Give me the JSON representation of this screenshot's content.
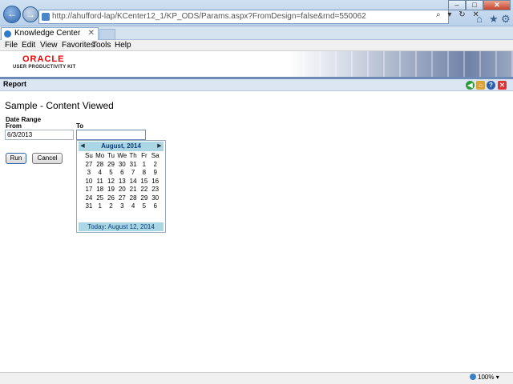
{
  "browser": {
    "url": "http://ahufford-lap/KCenter12_1/KP_ODS/Params.aspx?FromDesign=false&rnd=550062",
    "tab_title": "Knowledge Center",
    "tab_close": "✕",
    "back": "←",
    "forward": "→",
    "addr_tools": [
      "⌕",
      "▾",
      "↻",
      "✕"
    ],
    "win_min": "–",
    "win_max": "□",
    "win_close": "✕",
    "home": "⌂",
    "favorites": "★",
    "settings": "⚙",
    "menu": [
      "File",
      "Edit",
      "View",
      "Favorites",
      "Tools",
      "Help"
    ],
    "zoom": "100%"
  },
  "app": {
    "logo_line1": "ORACLE",
    "logo_line2": "USER PRODUCTIVITY KIT",
    "section": "Report",
    "icons": {
      "back": "◀",
      "home": "⌂",
      "help": "?",
      "exit": "✕"
    }
  },
  "form": {
    "title": "Sample - Content Viewed",
    "date_range_label": "Date Range",
    "from_label": "From",
    "to_label": "To",
    "from_value": "6/3/2013",
    "to_value": "",
    "run_label": "Run",
    "cancel_label": "Cancel"
  },
  "calendar": {
    "title": "August, 2014",
    "prev": "◀",
    "next": "▶",
    "weekdays": [
      "Su",
      "Mo",
      "Tu",
      "We",
      "Th",
      "Fr",
      "Sa"
    ],
    "weeks": [
      [
        "27",
        "28",
        "29",
        "30",
        "31",
        "1",
        "2"
      ],
      [
        "3",
        "4",
        "5",
        "6",
        "7",
        "8",
        "9"
      ],
      [
        "10",
        "11",
        "12",
        "13",
        "14",
        "15",
        "16"
      ],
      [
        "17",
        "18",
        "19",
        "20",
        "21",
        "22",
        "23"
      ],
      [
        "24",
        "25",
        "26",
        "27",
        "28",
        "29",
        "30"
      ],
      [
        "31",
        "1",
        "2",
        "3",
        "4",
        "5",
        "6"
      ]
    ],
    "today_label": "Today: August 12, 2014"
  }
}
